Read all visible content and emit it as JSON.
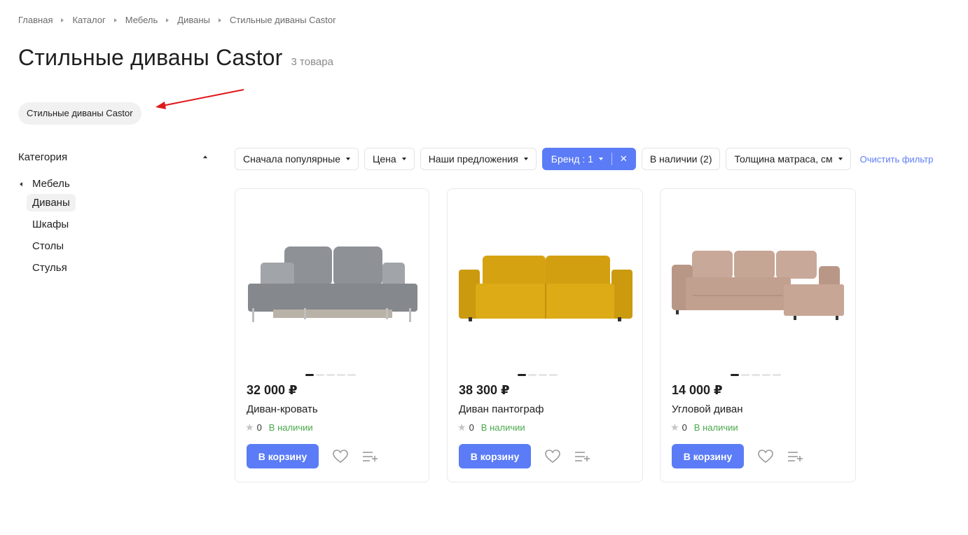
{
  "breadcrumbs": [
    "Главная",
    "Каталог",
    "Мебель",
    "Диваны",
    "Стильные диваны Castor"
  ],
  "page": {
    "title": "Стильные диваны Castor",
    "count": "3 товара"
  },
  "tag": {
    "label": "Стильные диваны Castor"
  },
  "sidebar": {
    "title": "Категория",
    "parent": "Мебель",
    "items": [
      {
        "label": "Диваны",
        "active": true
      },
      {
        "label": "Шкафы",
        "active": false
      },
      {
        "label": "Столы",
        "active": false
      },
      {
        "label": "Стулья",
        "active": false
      }
    ]
  },
  "filters": {
    "sort": "Сначала популярные",
    "price": "Цена",
    "offers": "Наши предложения",
    "brand": "Бренд : 1",
    "brand_clear": "✕",
    "stock": "В наличии (2)",
    "mattress": "Толщина матраса, см",
    "clear": "Очистить фильтр"
  },
  "products": [
    {
      "price": "32 000 ₽",
      "name": "Диван-кровать",
      "rating": "0",
      "stock": "В наличии",
      "cart": "В корзину",
      "icon": "sofa-grey-image",
      "dots": 5
    },
    {
      "price": "38 300 ₽",
      "name": "Диван пантограф",
      "rating": "0",
      "stock": "В наличии",
      "cart": "В корзину",
      "icon": "sofa-yellow-image",
      "dots": 4
    },
    {
      "price": "14 000 ₽",
      "name": "Угловой диван",
      "rating": "0",
      "stock": "В наличии",
      "cart": "В корзину",
      "icon": "sofa-beige-corner-image",
      "dots": 5
    }
  ],
  "colors": {
    "accent": "#5b7cf6",
    "stock": "#4aa84c",
    "annotation": "#e0171b"
  }
}
